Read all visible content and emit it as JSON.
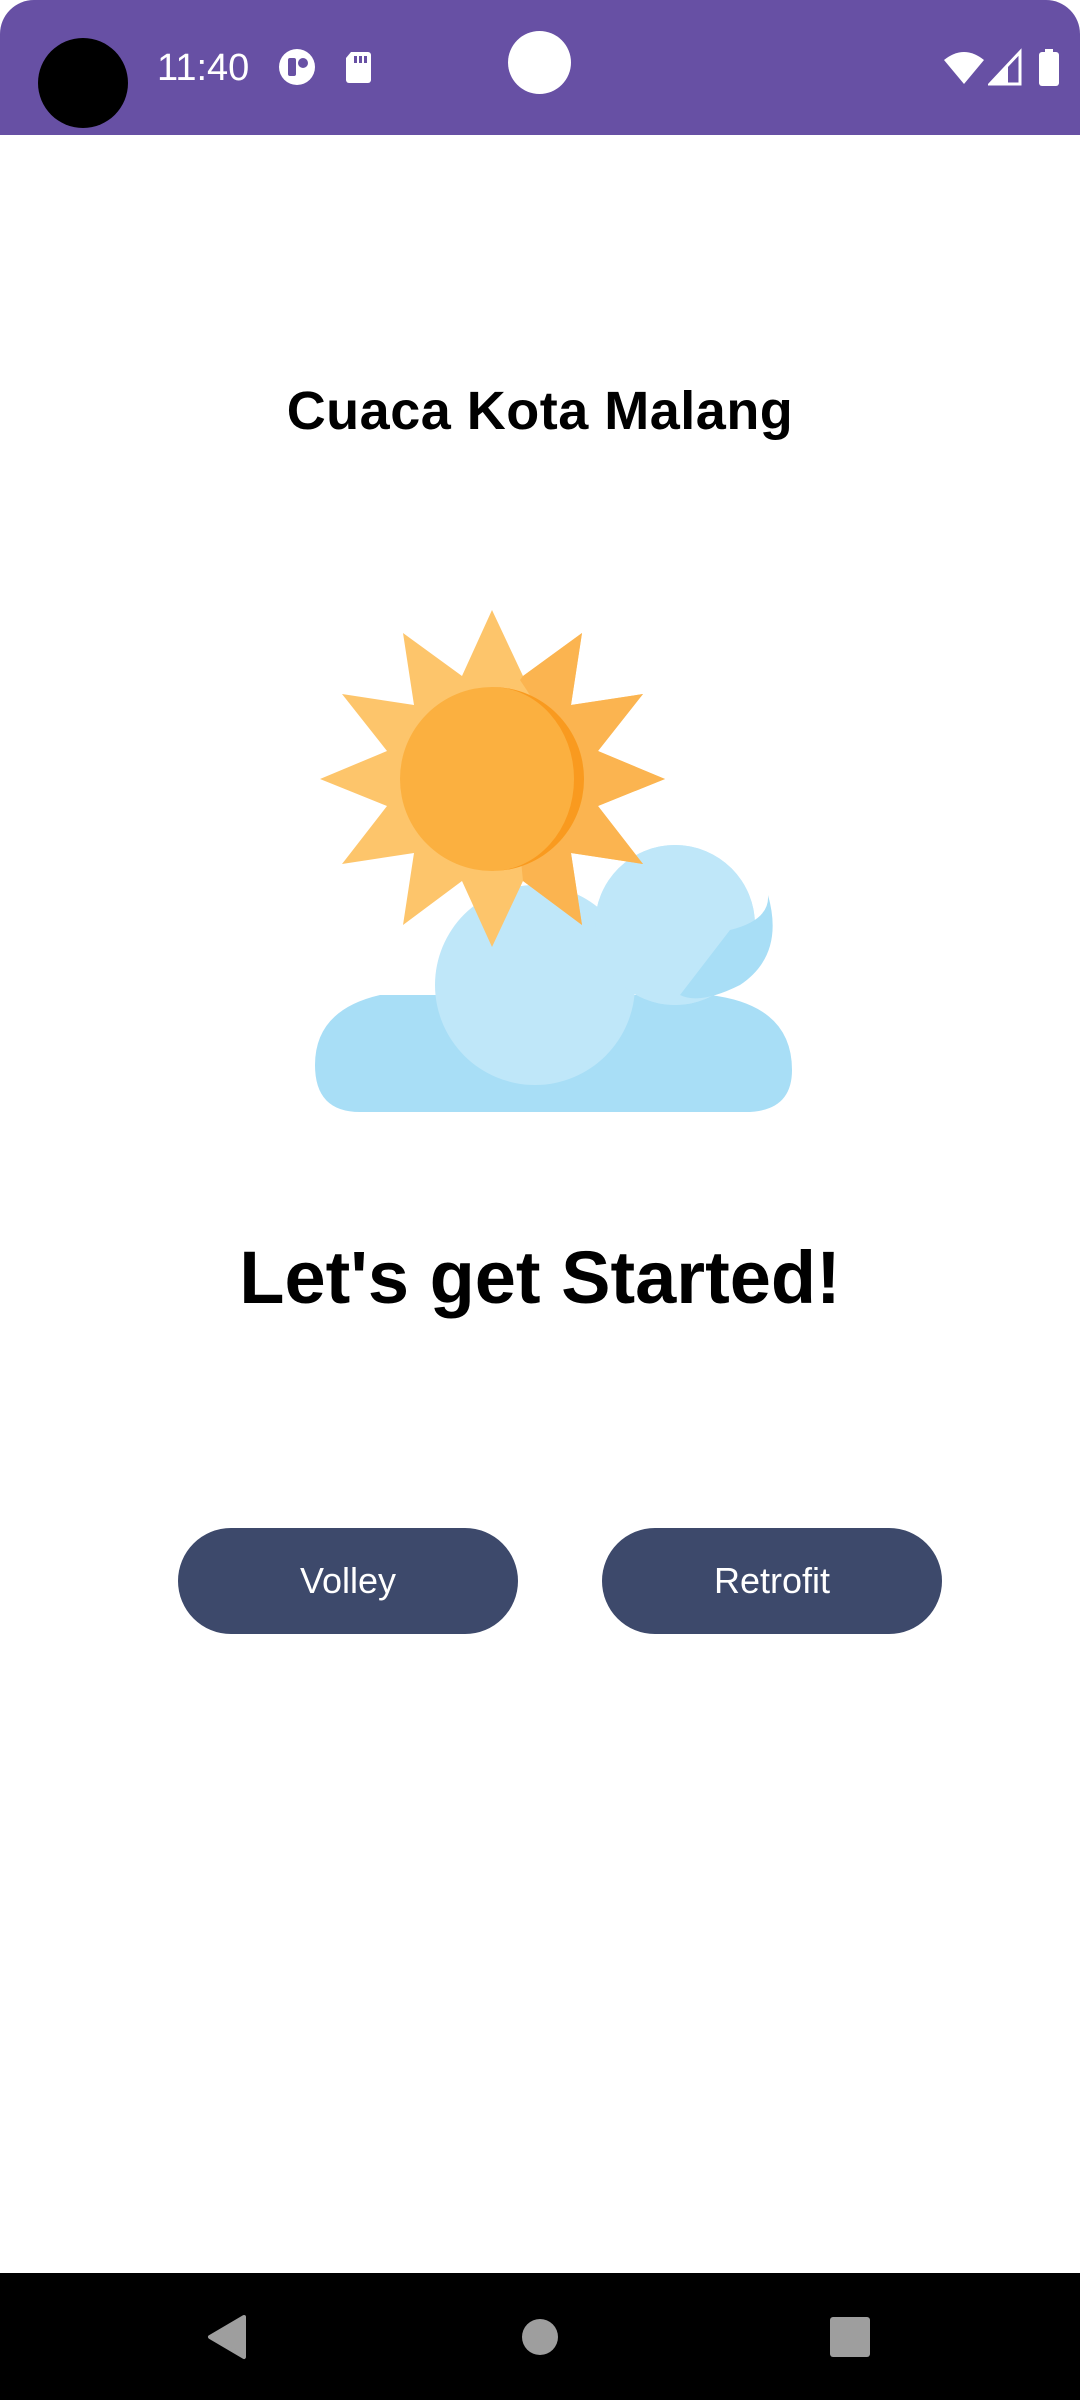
{
  "status_bar": {
    "time": "11:40",
    "background_color": "#6750A4",
    "left_icons": [
      "data-saver-icon",
      "sd-card-icon"
    ],
    "right_icons": [
      "wifi-icon",
      "cell-signal-icon",
      "battery-icon"
    ]
  },
  "main": {
    "title": "Cuaca Kota Malang",
    "illustration": "sun-behind-cloud-icon",
    "headline": "Let's get Started!",
    "buttons": {
      "volley_label": "Volley",
      "retrofit_label": "Retrofit"
    },
    "button_color": "#3D496B"
  },
  "nav_bar": {
    "icons": [
      "back-icon",
      "home-icon",
      "recents-icon"
    ]
  }
}
